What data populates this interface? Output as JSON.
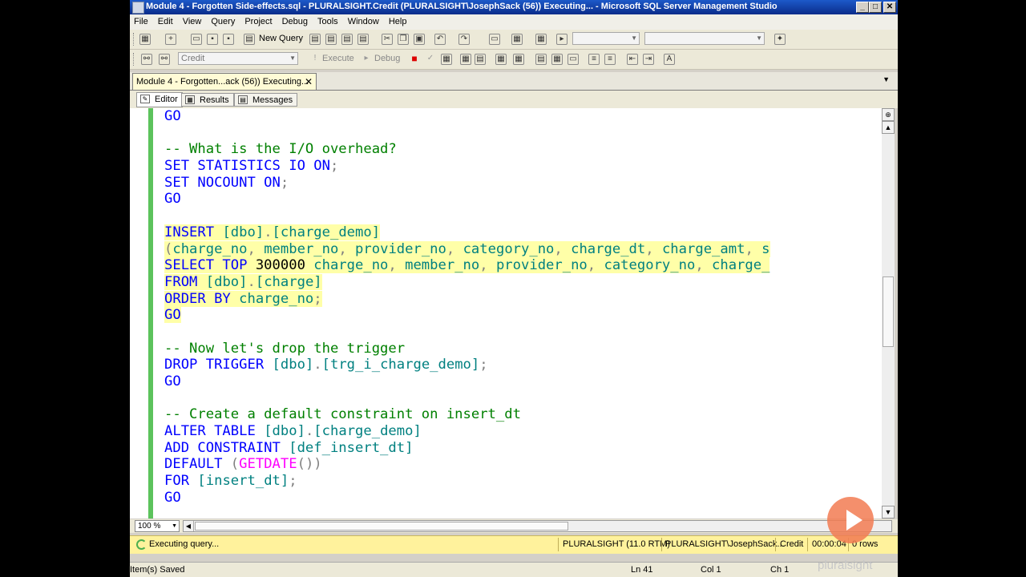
{
  "window": {
    "title": "Module 4 - Forgotten Side-effects.sql - PLURALSIGHT.Credit (PLURALSIGHT\\JosephSack (56)) Executing... - Microsoft SQL Server Management Studio",
    "min": "_",
    "max": "□",
    "close": "✕"
  },
  "menu": [
    "File",
    "Edit",
    "View",
    "Query",
    "Project",
    "Debug",
    "Tools",
    "Window",
    "Help"
  ],
  "toolbar1": {
    "new_query": "New Query"
  },
  "toolbar2": {
    "database": "Credit",
    "execute": "Execute",
    "debug": "Debug"
  },
  "doc_tab": {
    "label": "Module 4 - Forgotten...ack (56)) Executing...",
    "close": "✕"
  },
  "sub_tabs": [
    "Editor",
    "Results",
    "Messages"
  ],
  "code_lines": [
    [
      [
        "kw",
        "GO"
      ]
    ],
    [],
    [
      [
        "cm",
        "-- What is the I/O overhead?"
      ]
    ],
    [
      [
        "kw",
        "SET STATISTICS IO ON"
      ],
      [
        "sy",
        ";"
      ]
    ],
    [
      [
        "kw",
        "SET NOCOUNT ON"
      ],
      [
        "sy",
        ";"
      ]
    ],
    [
      [
        "kw",
        "GO"
      ]
    ],
    [],
    [
      [
        "kw",
        "INSERT "
      ],
      [
        "id",
        "[dbo]"
      ],
      [
        "sy",
        "."
      ],
      [
        "id",
        "[charge_demo]"
      ]
    ],
    [
      [
        "sy",
        "("
      ],
      [
        "id",
        "charge_no"
      ],
      [
        "sy",
        ", "
      ],
      [
        "id",
        "member_no"
      ],
      [
        "sy",
        ", "
      ],
      [
        "id",
        "provider_no"
      ],
      [
        "sy",
        ", "
      ],
      [
        "id",
        "category_no"
      ],
      [
        "sy",
        ", "
      ],
      [
        "id",
        "charge_dt"
      ],
      [
        "sy",
        ", "
      ],
      [
        "id",
        "charge_amt"
      ],
      [
        "sy",
        ", "
      ],
      [
        "id",
        "s"
      ]
    ],
    [
      [
        "kw",
        "SELECT TOP "
      ],
      [
        "pl",
        "300000 "
      ],
      [
        "id",
        "charge_no"
      ],
      [
        "sy",
        ", "
      ],
      [
        "id",
        "member_no"
      ],
      [
        "sy",
        ", "
      ],
      [
        "id",
        "provider_no"
      ],
      [
        "sy",
        ", "
      ],
      [
        "id",
        "category_no"
      ],
      [
        "sy",
        ", "
      ],
      [
        "id",
        "charge_"
      ]
    ],
    [
      [
        "kw",
        "FROM "
      ],
      [
        "id",
        "[dbo]"
      ],
      [
        "sy",
        "."
      ],
      [
        "id",
        "[charge]"
      ]
    ],
    [
      [
        "kw",
        "ORDER BY "
      ],
      [
        "id",
        "charge_no"
      ],
      [
        "sy",
        ";"
      ]
    ],
    [
      [
        "kw",
        "GO"
      ]
    ],
    [],
    [
      [
        "cm",
        "-- Now let's drop the trigger"
      ]
    ],
    [
      [
        "kw",
        "DROP TRIGGER "
      ],
      [
        "id",
        "[dbo]"
      ],
      [
        "sy",
        "."
      ],
      [
        "id",
        "[trg_i_charge_demo]"
      ],
      [
        "sy",
        ";"
      ]
    ],
    [
      [
        "kw",
        "GO"
      ]
    ],
    [],
    [
      [
        "cm",
        "-- Create a default constraint on insert_dt"
      ]
    ],
    [
      [
        "kw",
        "ALTER TABLE "
      ],
      [
        "id",
        "[dbo]"
      ],
      [
        "sy",
        "."
      ],
      [
        "id",
        "[charge_demo]"
      ]
    ],
    [
      [
        "kw",
        "ADD CONSTRAINT "
      ],
      [
        "id",
        "[def_insert_dt]"
      ]
    ],
    [
      [
        "kw",
        "DEFAULT "
      ],
      [
        "sy",
        "("
      ],
      [
        "fn",
        "GETDATE"
      ],
      [
        "sy",
        "())"
      ]
    ],
    [
      [
        "kw",
        "FOR "
      ],
      [
        "id",
        "[insert_dt]"
      ],
      [
        "sy",
        ";"
      ]
    ],
    [
      [
        "kw",
        "GO"
      ]
    ]
  ],
  "selected_lines": [
    7,
    8,
    9,
    10,
    11,
    12
  ],
  "editor": {
    "zoom": "100 %"
  },
  "query_status": {
    "state": "Executing query...",
    "server": "PLURALSIGHT (11.0 RTM)",
    "user": "PLURALSIGHT\\JosephSack...",
    "database": "Credit",
    "elapsed": "00:00:04",
    "rows": "0 rows"
  },
  "status_bar": {
    "message": "Item(s) Saved",
    "line": "Ln 41",
    "col": "Col 1",
    "ch": "Ch 1"
  },
  "brand": {
    "name": "pluralsight"
  }
}
